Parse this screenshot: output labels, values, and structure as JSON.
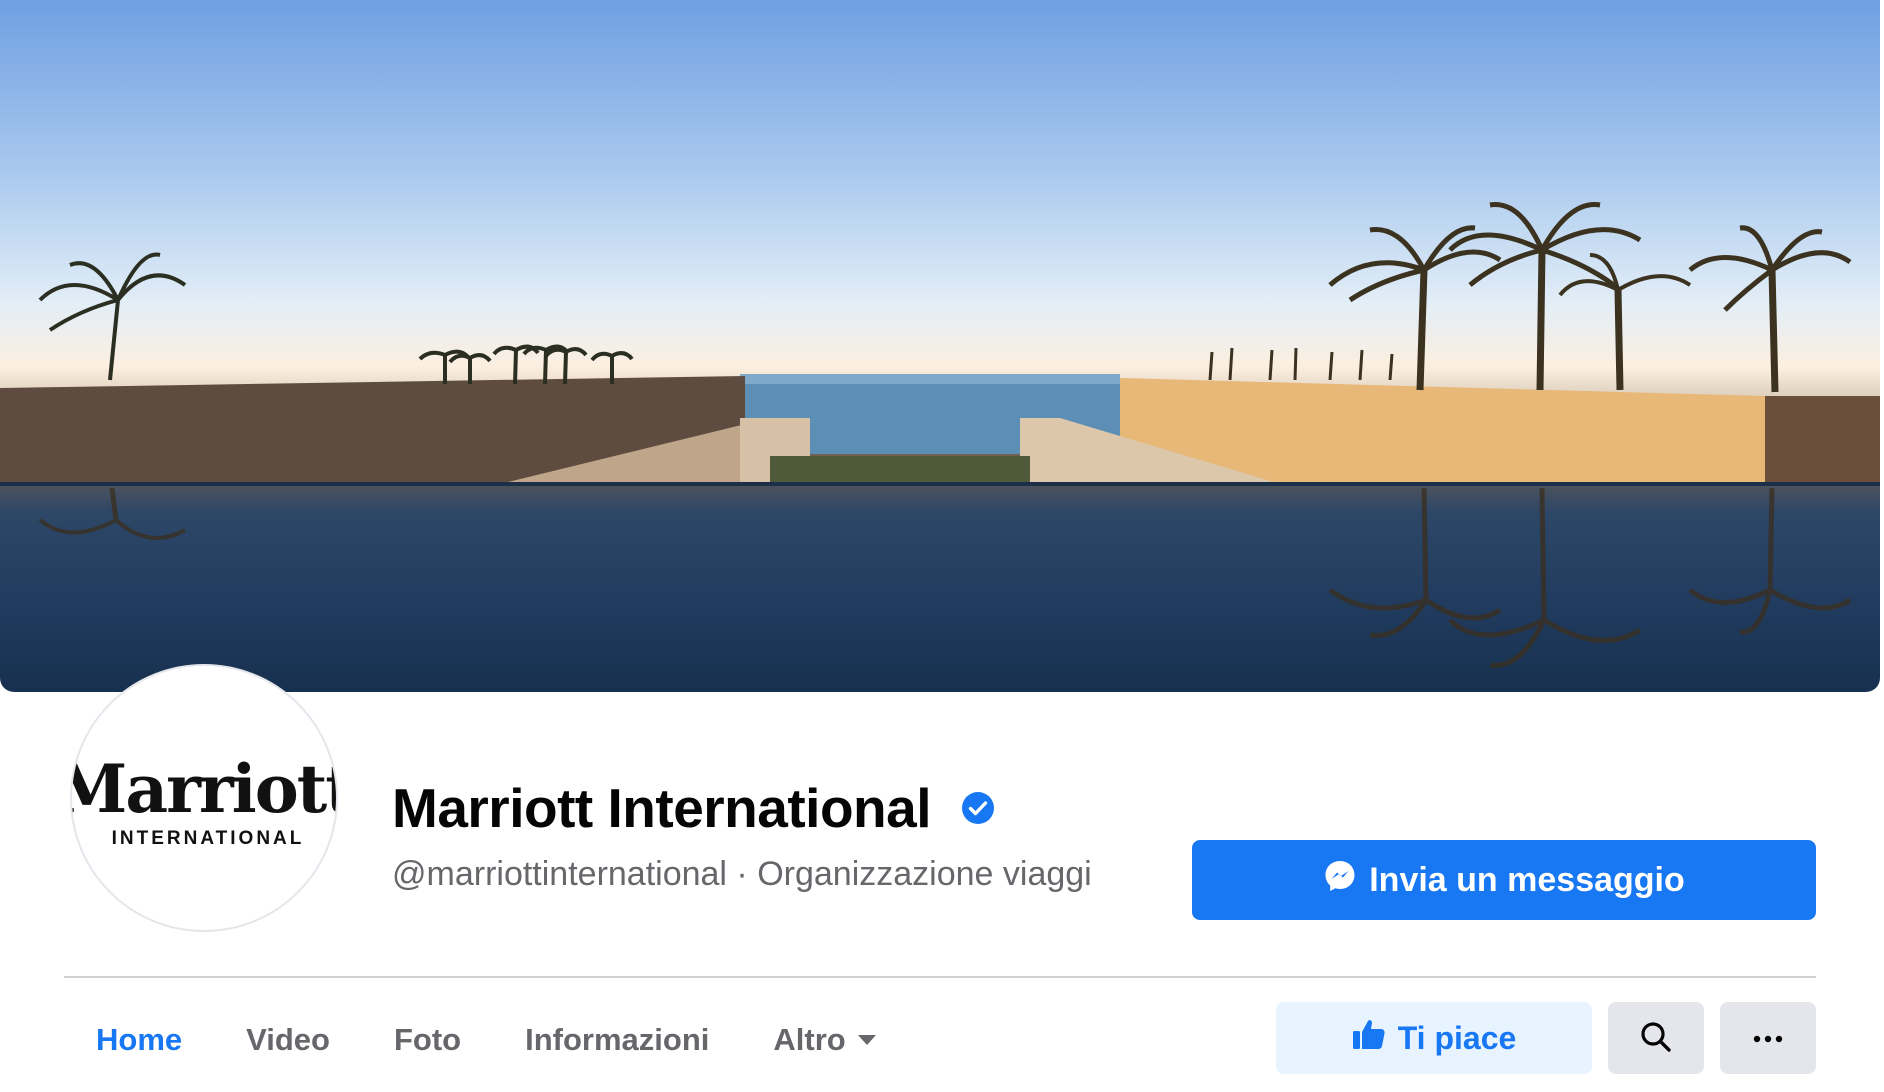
{
  "profile": {
    "logo_wordmark": "Marriott",
    "logo_sub": "INTERNATIONAL",
    "name": "Marriott International",
    "subtitle": "@marriottinternational · Organizzazione viaggi"
  },
  "actions": {
    "message_label": "Invia un messaggio",
    "like_label": "Ti piace"
  },
  "tabs": [
    {
      "label": "Home",
      "active": true
    },
    {
      "label": "Video",
      "active": false
    },
    {
      "label": "Foto",
      "active": false
    },
    {
      "label": "Informazioni",
      "active": false
    },
    {
      "label": "Altro",
      "active": false,
      "dropdown": true
    }
  ],
  "icons": {
    "verified": "verified-badge-icon",
    "messenger": "messenger-icon",
    "like": "thumbs-up-icon",
    "search": "search-icon",
    "more": "more-options-icon",
    "dropdown": "caret-down-icon"
  },
  "colors": {
    "accent": "#1877f2",
    "accent_light": "#e7f3ff",
    "text_primary": "#050505",
    "text_secondary": "#65676b",
    "button_gray": "#e4e6eb"
  }
}
